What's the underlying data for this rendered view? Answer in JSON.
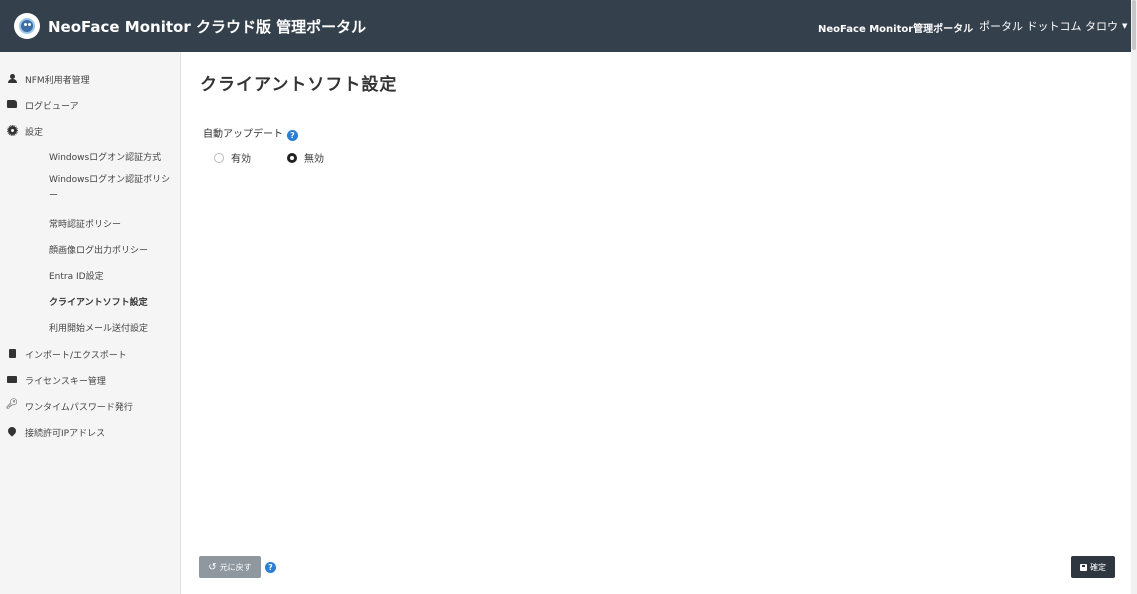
{
  "header": {
    "logo_icon": "neoface-logo-icon",
    "title": "NeoFace Monitor クラウド版 管理ポータル",
    "portal_name": "NeoFace Monitor管理ポータル",
    "user_name": "ポータル ドットコム タロウ",
    "background_color": "#35404d"
  },
  "sidebar": {
    "items": [
      {
        "label": "NFM利用者管理",
        "icon": "user-icon"
      },
      {
        "label": "ログビューア",
        "icon": "scroll-icon"
      },
      {
        "label": "設定",
        "icon": "gear-icon"
      },
      {
        "label": "インポート/エクスポート",
        "icon": "file-icon"
      },
      {
        "label": "ライセンスキー管理",
        "icon": "key-badge-icon"
      },
      {
        "label": "ワンタイムパスワード発行",
        "icon": "key-icon"
      },
      {
        "label": "接続許可IPアドレス",
        "icon": "map-pin-icon"
      }
    ],
    "settings_sub": [
      {
        "label": "Windowsログオン認証方式"
      },
      {
        "label": "Windowsログオン認証ポリシー"
      },
      {
        "label": "常時認証ポリシー"
      },
      {
        "label": "顔画像ログ出力ポリシー"
      },
      {
        "label": "Entra ID設定"
      },
      {
        "label": "クライアントソフト設定",
        "active": true
      },
      {
        "label": "利用開始メール送付設定"
      }
    ]
  },
  "main": {
    "page_title": "クライアントソフト設定",
    "auto_update": {
      "label": "自動アップデート",
      "options": [
        {
          "label": "有効",
          "checked": false
        },
        {
          "label": "無効",
          "checked": true
        }
      ]
    },
    "help_glyph": "?"
  },
  "footer": {
    "revert_label": "元に戻す",
    "confirm_label": "確定",
    "confirm_color": "#2e3740",
    "revert_color": "#8f979f"
  },
  "accent_color": "#2a7fd4"
}
